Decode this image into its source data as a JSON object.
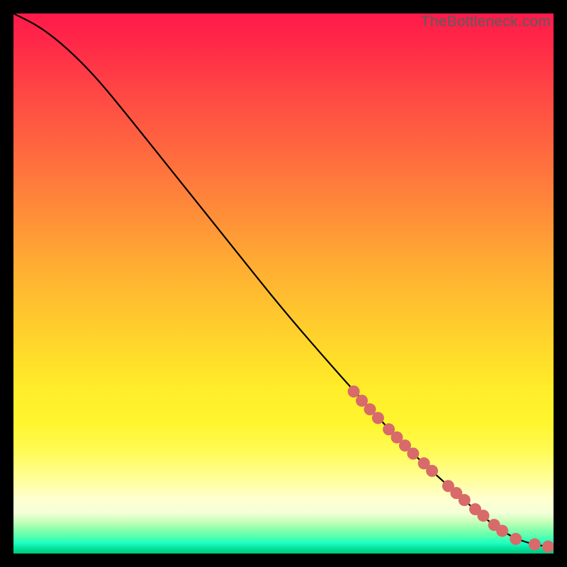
{
  "watermark": "TheBottleneck.com",
  "colors": {
    "curve": "#000000",
    "marker_fill": "#d86a6a",
    "marker_stroke": "#b64f4f"
  },
  "chart_data": {
    "type": "line",
    "title": "",
    "xlabel": "",
    "ylabel": "",
    "xlim": [
      0,
      100
    ],
    "ylim": [
      0,
      100
    ],
    "grid": false,
    "legend": false,
    "curve": [
      {
        "x": 0,
        "y": 100
      },
      {
        "x": 5,
        "y": 97.5
      },
      {
        "x": 10,
        "y": 93.5
      },
      {
        "x": 15,
        "y": 88.5
      },
      {
        "x": 20,
        "y": 82.5
      },
      {
        "x": 30,
        "y": 70
      },
      {
        "x": 40,
        "y": 57.5
      },
      {
        "x": 50,
        "y": 45
      },
      {
        "x": 60,
        "y": 33.5
      },
      {
        "x": 65,
        "y": 28
      },
      {
        "x": 70,
        "y": 22.5
      },
      {
        "x": 75,
        "y": 17.5
      },
      {
        "x": 80,
        "y": 13
      },
      {
        "x": 85,
        "y": 8.5
      },
      {
        "x": 88,
        "y": 6
      },
      {
        "x": 90,
        "y": 4.5
      },
      {
        "x": 92,
        "y": 3.3
      },
      {
        "x": 94,
        "y": 2.4
      },
      {
        "x": 96,
        "y": 1.8
      },
      {
        "x": 98,
        "y": 1.4
      },
      {
        "x": 100,
        "y": 1.2
      }
    ],
    "markers": [
      {
        "x": 63,
        "y": 30
      },
      {
        "x": 64.5,
        "y": 28.3
      },
      {
        "x": 66,
        "y": 26.7
      },
      {
        "x": 67.5,
        "y": 25.1
      },
      {
        "x": 69.5,
        "y": 23
      },
      {
        "x": 71,
        "y": 21.5
      },
      {
        "x": 72.5,
        "y": 20
      },
      {
        "x": 74,
        "y": 18.5
      },
      {
        "x": 76,
        "y": 16.7
      },
      {
        "x": 77.5,
        "y": 15.3
      },
      {
        "x": 80.5,
        "y": 12.5
      },
      {
        "x": 82,
        "y": 11.2
      },
      {
        "x": 83.5,
        "y": 9.9
      },
      {
        "x": 85.5,
        "y": 8.2
      },
      {
        "x": 87,
        "y": 7
      },
      {
        "x": 89,
        "y": 5.3
      },
      {
        "x": 90.5,
        "y": 4.2
      },
      {
        "x": 93,
        "y": 2.7
      },
      {
        "x": 96.5,
        "y": 1.7
      },
      {
        "x": 99,
        "y": 1.3
      }
    ]
  }
}
